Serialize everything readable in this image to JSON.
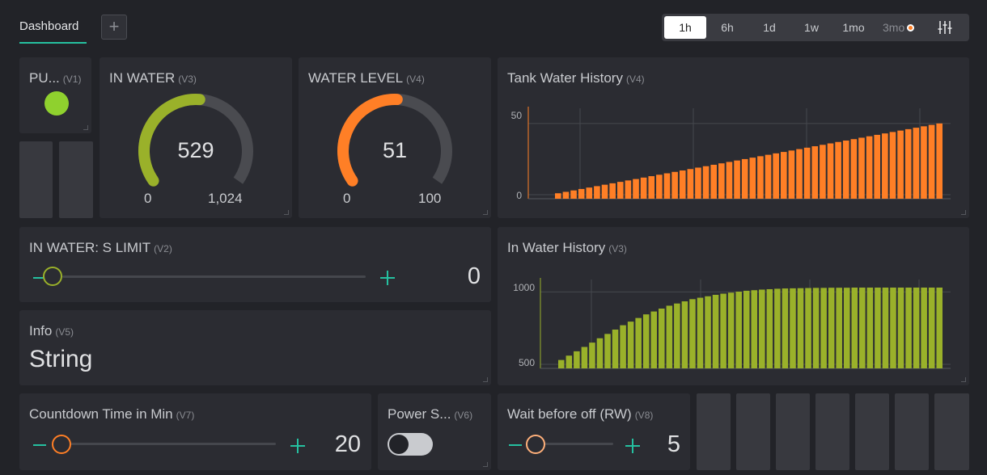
{
  "dashboard_tab": "Dashboard",
  "add_icon": "plus-icon",
  "time_ranges": [
    "1h",
    "6h",
    "1d",
    "1w",
    "1mo",
    "3mo"
  ],
  "selected_range": "1h",
  "settings_icon": "sliders-icon",
  "widgets": {
    "pump": {
      "title": "PU...",
      "pin": "(V1)",
      "led_color": "#8fd12e"
    },
    "in_water": {
      "title": "IN WATER",
      "pin": "(V3)",
      "value": "529",
      "min": "0",
      "max": "1,024",
      "fraction": 0.517,
      "color": "#9ab12a"
    },
    "water_level": {
      "title": "WATER LEVEL",
      "pin": "(V4)",
      "value": "51",
      "min": "0",
      "max": "100",
      "fraction": 0.51,
      "color": "#ff7f26"
    },
    "tank_history": {
      "title": "Tank Water History",
      "pin": "(V4)",
      "y_labels": [
        "50",
        "0"
      ],
      "color": "#ff7f26"
    },
    "in_water_history": {
      "title": "In Water History",
      "pin": "(V3)",
      "y_labels": [
        "1000",
        "500"
      ],
      "color": "#9ab12a"
    },
    "s_limit": {
      "title": "IN WATER: S LIMIT",
      "pin": "(V2)",
      "value": "0",
      "fraction": 0.0,
      "color": "#9ab12a"
    },
    "info": {
      "title": "Info",
      "pin": "(V5)",
      "value": "String"
    },
    "countdown": {
      "title": "Countdown Time in Min",
      "pin": "(V7)",
      "value": "20",
      "fraction": 0.0,
      "color": "#ff7f26"
    },
    "power_switch": {
      "title": "Power S...",
      "pin": "(V6)",
      "state": "off"
    },
    "wait_before_off": {
      "title": "Wait before off (RW)",
      "pin": "(V8)",
      "value": "5",
      "fraction": 0.0,
      "color": "#ffb07a"
    }
  },
  "chart_data": [
    {
      "type": "bar",
      "title": "Tank Water History",
      "series": [
        {
          "values": [
            1,
            2,
            3,
            4,
            5,
            6,
            7,
            8,
            9,
            10,
            11,
            12,
            13,
            14,
            15,
            16,
            17,
            18,
            19,
            20,
            21,
            22,
            23,
            24,
            25,
            26,
            27,
            28,
            29,
            30,
            31,
            32,
            33,
            34,
            35,
            36,
            37,
            38,
            39,
            40,
            41,
            42,
            43,
            44,
            45,
            46,
            47,
            48,
            49,
            50
          ]
        }
      ],
      "ylim": [
        0,
        55
      ],
      "yticks": [
        0,
        50
      ]
    },
    {
      "type": "bar",
      "title": "In Water History",
      "series": [
        {
          "values": [
            530,
            560,
            590,
            620,
            650,
            680,
            710,
            740,
            770,
            795,
            820,
            845,
            865,
            885,
            905,
            920,
            935,
            950,
            960,
            970,
            980,
            988,
            995,
            1002,
            1008,
            1012,
            1016,
            1019,
            1022,
            1024,
            1025,
            1026,
            1027,
            1028,
            1028,
            1029,
            1029,
            1029,
            1030,
            1030,
            1030,
            1030,
            1030,
            1030,
            1030,
            1030,
            1030,
            1030,
            1030,
            1030
          ]
        }
      ],
      "ylim": [
        500,
        1030
      ],
      "yticks": [
        500,
        1000
      ]
    }
  ]
}
